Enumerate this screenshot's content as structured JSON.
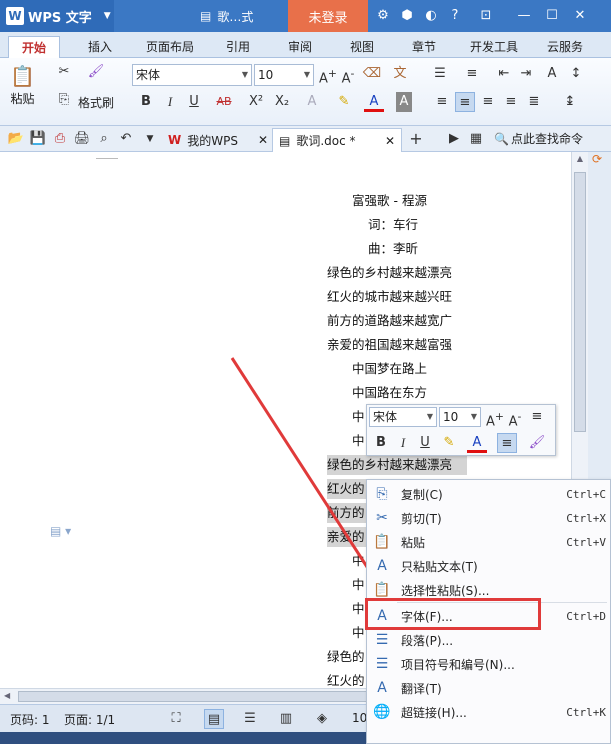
{
  "app": {
    "name": "WPS 文字",
    "logo_letter": "W",
    "doc_title": "歌…式",
    "login_label": "未登录"
  },
  "tabs": [
    "开始",
    "插入",
    "页面布局",
    "引用",
    "审阅",
    "视图",
    "章节",
    "开发工具",
    "云服务"
  ],
  "ribbon": {
    "paste_label": "粘贴",
    "format_painter_label": "格式刷",
    "font_name": "宋体",
    "font_size": "10"
  },
  "toolbar2": {
    "wps_tab_label": "我的WPS",
    "doc_tab_label": "歌词.doc *",
    "search_label": "点此查找命令"
  },
  "document": {
    "lines": [
      "富强歌 - 程源",
      "词：车行",
      "曲：李昕",
      "绿色的乡村越来越漂亮",
      "红火的城市越来越兴旺",
      "前方的道路越来越宽广",
      "亲爱的祖国越来越富强",
      "中国梦在路上",
      "中国路在东方",
      "中",
      "中",
      "绿色的乡村越来越漂亮",
      "红火的",
      "前方的",
      "亲爱的",
      "中",
      "中",
      "中",
      "中",
      "绿色的",
      "红火的"
    ]
  },
  "mini_toolbar": {
    "font_name": "宋体",
    "font_size": "10"
  },
  "context_menu": {
    "items": [
      {
        "label": "复制(C)",
        "shortcut": "Ctrl+C",
        "icon": "copy-icon"
      },
      {
        "label": "剪切(T)",
        "shortcut": "Ctrl+X",
        "icon": "cut-icon"
      },
      {
        "label": "粘贴",
        "shortcut": "Ctrl+V",
        "icon": "paste-icon"
      },
      {
        "label": "只粘贴文本(T)",
        "shortcut": "",
        "icon": "paste-text-icon"
      },
      {
        "label": "选择性粘贴(S)...",
        "shortcut": "",
        "icon": "paste-special-icon"
      },
      {
        "label": "字体(F)...",
        "shortcut": "Ctrl+D",
        "icon": "font-icon"
      },
      {
        "label": "段落(P)...",
        "shortcut": "",
        "icon": "paragraph-icon"
      },
      {
        "label": "项目符号和编号(N)...",
        "shortcut": "",
        "icon": "bullets-icon"
      },
      {
        "label": "翻译(T)",
        "shortcut": "",
        "icon": "translate-icon"
      },
      {
        "label": "超链接(H)...",
        "shortcut": "Ctrl+K",
        "icon": "hyperlink-icon"
      }
    ]
  },
  "status": {
    "page_num": "页码: 1",
    "page_count": "页面: 1/1",
    "zoom_partial": "10"
  },
  "colors": {
    "accent": "#3b78c4",
    "login": "#e8704a",
    "highlight_box": "#e03a3a",
    "arrow": "#e03a3a"
  }
}
